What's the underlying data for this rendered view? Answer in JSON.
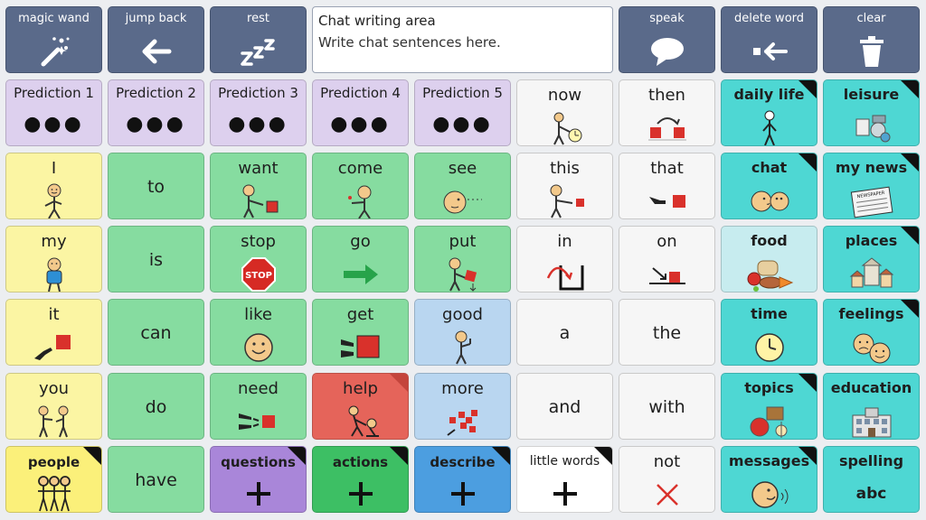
{
  "toolbar": {
    "magic_wand": "magic wand",
    "jump_back": "jump back",
    "rest": "rest",
    "speak": "speak",
    "delete_word": "delete word",
    "clear": "clear"
  },
  "chat": {
    "title": "Chat writing area",
    "placeholder": "Write chat sentences here."
  },
  "predictions": [
    "Prediction 1",
    "Prediction 2",
    "Prediction 3",
    "Prediction 4",
    "Prediction 5"
  ],
  "words": {
    "now": "now",
    "then": "then",
    "i": "I",
    "to": "to",
    "want": "want",
    "come": "come",
    "see": "see",
    "this": "this",
    "that": "that",
    "my": "my",
    "is": "is",
    "stop": "stop",
    "go": "go",
    "put": "put",
    "in": "in",
    "on": "on",
    "it": "it",
    "can": "can",
    "like": "like",
    "get": "get",
    "good": "good",
    "a": "a",
    "the": "the",
    "you": "you",
    "do": "do",
    "need": "need",
    "help": "help",
    "more": "more",
    "and": "and",
    "with": "with",
    "have": "have",
    "not": "not"
  },
  "symbol_text": {
    "stop_sign": "STOP",
    "newspaper": "NEWSPAPER"
  },
  "folders": {
    "daily_life": "daily life",
    "leisure": "leisure",
    "chat": "chat",
    "my_news": "my news",
    "food": "food",
    "places": "places",
    "time": "time",
    "feelings": "feelings",
    "topics": "topics",
    "education": "education",
    "messages": "messages",
    "spelling": "spelling",
    "spelling_sub": "abc"
  },
  "categories": {
    "people": "people",
    "questions": "questions",
    "actions": "actions",
    "describe": "describe",
    "little_words": "little words"
  }
}
